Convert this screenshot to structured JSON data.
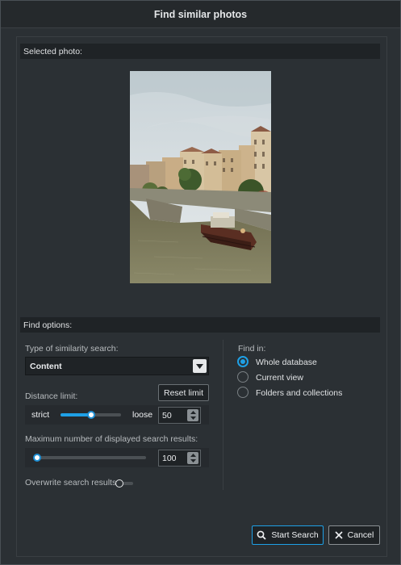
{
  "dialog": {
    "title": "Find similar photos"
  },
  "selected_photo": {
    "header": "Selected photo:"
  },
  "find_options": {
    "header": "Find options:",
    "similarity_type_label": "Type of similarity search:",
    "similarity_type_value": "Content",
    "distance_limit_label": "Distance limit:",
    "reset_limit_label": "Reset limit",
    "strict_label": "strict",
    "loose_label": "loose",
    "distance_value": "50",
    "distance_fraction": 0.5,
    "max_results_label": "Maximum number of displayed search results:",
    "max_results_value": "100",
    "max_results_fraction": 0.0,
    "overwrite_label": "Overwrite search results:",
    "overwrite_on": false
  },
  "find_in": {
    "label": "Find in:",
    "options": [
      {
        "label": "Whole database",
        "checked": true
      },
      {
        "label": "Current view",
        "checked": false
      },
      {
        "label": "Folders and collections",
        "checked": false
      }
    ]
  },
  "actions": {
    "start_search": "Start Search",
    "cancel": "Cancel"
  },
  "colors": {
    "accent": "#1ea0e6",
    "background": "#2b3034",
    "header": "#1f2326"
  },
  "icons": {
    "search": "search-icon",
    "cancel": "close-icon",
    "dropdown": "chevron-down-icon"
  }
}
